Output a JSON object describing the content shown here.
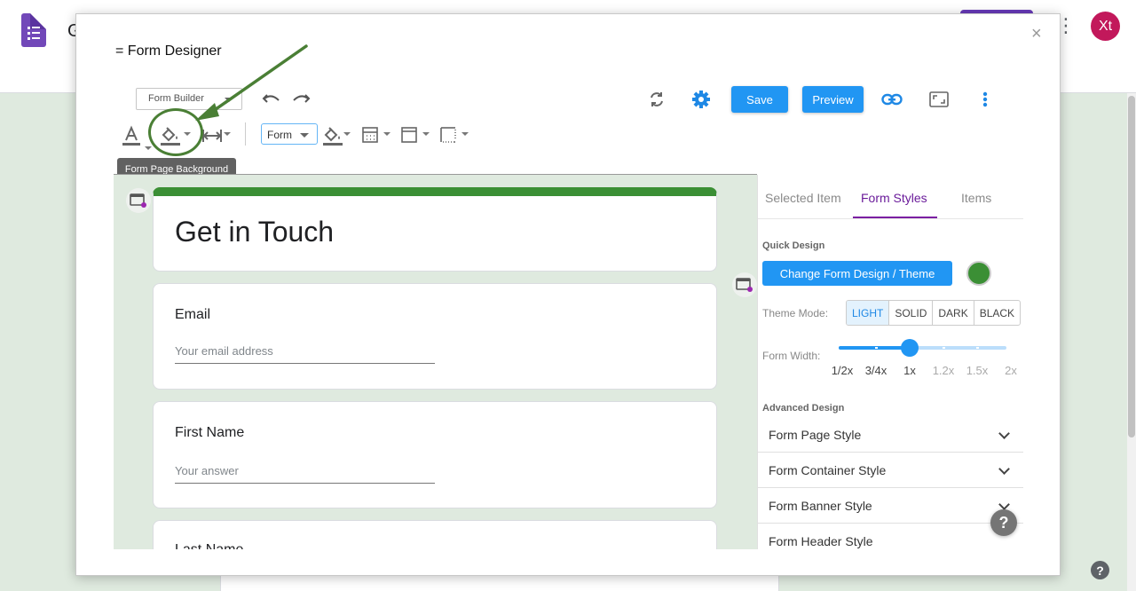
{
  "background": {
    "title_initial": "G",
    "avatar_initials": "Xt"
  },
  "modal": {
    "title": "= Form Designer",
    "close": "×"
  },
  "toolbar": {
    "builder_select": "Form Builder",
    "form_select": "Form",
    "save_label": "Save",
    "preview_label": "Preview",
    "tooltip": "Form Page Background"
  },
  "form": {
    "title": "Get in Touch",
    "questions": [
      {
        "label": "Email",
        "placeholder": "Your email address"
      },
      {
        "label": "First Name",
        "placeholder": "Your answer"
      },
      {
        "label": "Last Name",
        "placeholder": ""
      }
    ]
  },
  "panel": {
    "tabs": [
      "Selected Item",
      "Form Styles",
      "Items"
    ],
    "active_tab": "Form Styles",
    "quick_design_label": "Quick Design",
    "theme_button": "Change Form Design / Theme",
    "theme_color": "#3b8f35",
    "theme_mode_label": "Theme Mode:",
    "theme_modes": [
      "LIGHT",
      "SOLID",
      "DARK",
      "BLACK"
    ],
    "theme_mode_selected": "LIGHT",
    "form_width_label": "Form Width:",
    "width_marks": [
      "1/2x",
      "3/4x",
      "1x",
      "1.2x",
      "1.5x",
      "2x"
    ],
    "width_selected": "1x",
    "advanced_design_label": "Advanced Design",
    "sections": [
      "Form Page Style",
      "Form Container Style",
      "Form Banner Style",
      "Form Header Style"
    ]
  },
  "help": {
    "label": "?"
  }
}
